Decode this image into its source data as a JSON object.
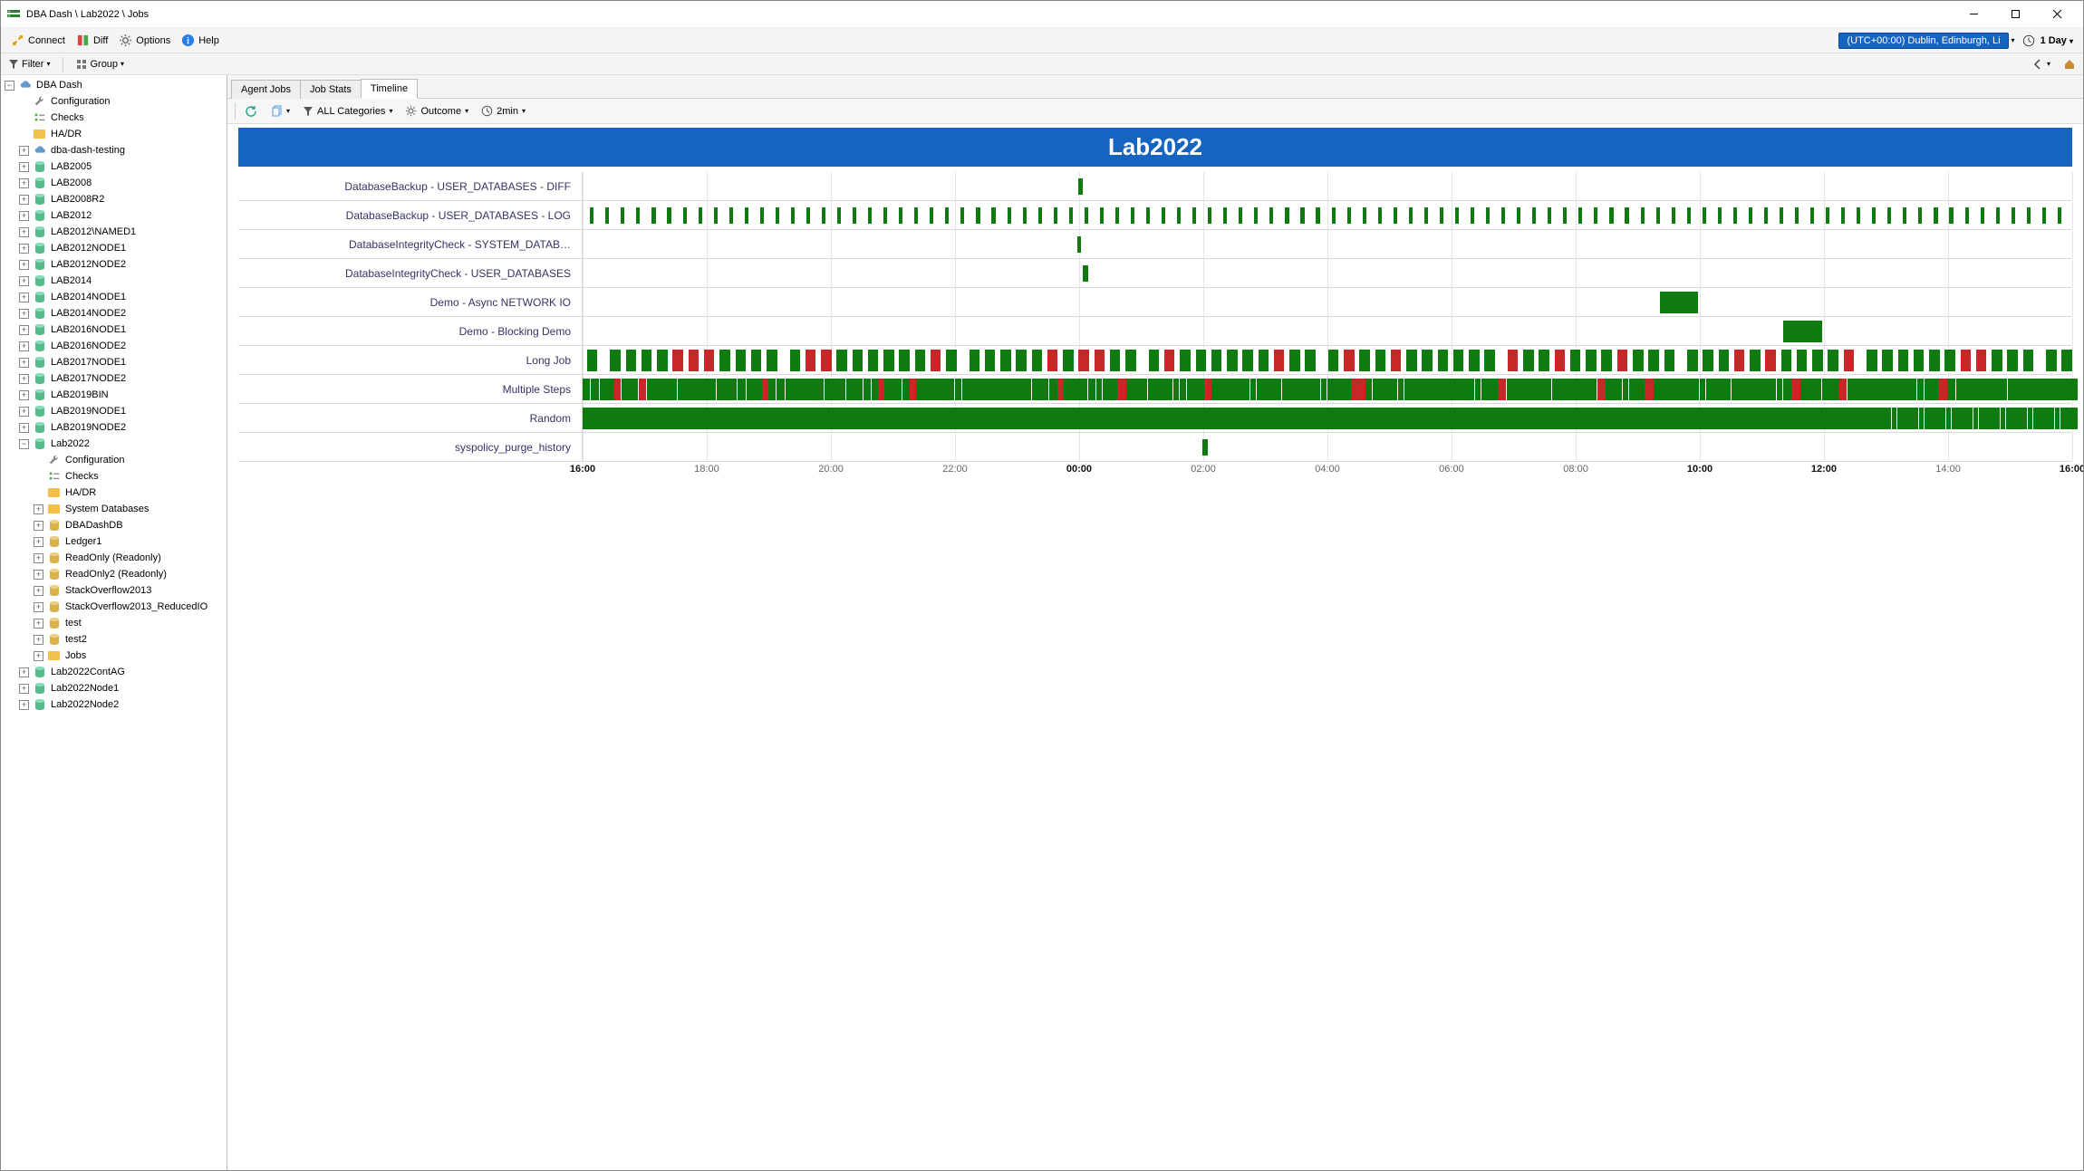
{
  "window": {
    "title": "DBA Dash \\ Lab2022 \\ Jobs"
  },
  "toolbar": {
    "connect": "Connect",
    "diff": "Diff",
    "options": "Options",
    "help": "Help",
    "tz": "(UTC+00:00) Dublin, Edinburgh, Li",
    "range": "1 Day"
  },
  "filterbar": {
    "filter": "Filter",
    "group": "Group"
  },
  "tabs": {
    "agentJobs": "Agent Jobs",
    "jobStats": "Job Stats",
    "timeline": "Timeline"
  },
  "subtoolbar": {
    "categories": "ALL Categories",
    "outcome": "Outcome",
    "granularity": "2min"
  },
  "timeline": {
    "title": "Lab2022",
    "ticks": [
      {
        "pos": 0,
        "label": "16:00",
        "major": true
      },
      {
        "pos": 8.33,
        "label": "18:00"
      },
      {
        "pos": 16.67,
        "label": "20:00"
      },
      {
        "pos": 25,
        "label": "22:00"
      },
      {
        "pos": 33.33,
        "label": "00:00",
        "major": true
      },
      {
        "pos": 41.67,
        "label": "02:00"
      },
      {
        "pos": 50,
        "label": "04:00"
      },
      {
        "pos": 58.33,
        "label": "06:00"
      },
      {
        "pos": 66.67,
        "label": "08:00"
      },
      {
        "pos": 75,
        "label": "10:00",
        "major": true
      },
      {
        "pos": 83.33,
        "label": "12:00",
        "major": true
      },
      {
        "pos": 91.67,
        "label": "14:00"
      },
      {
        "pos": 100,
        "label": "16:00",
        "major": true
      }
    ],
    "rows": [
      {
        "name": "DatabaseBackup - USER_DATABASES - DIFF",
        "bars": [
          {
            "x": 33.3,
            "w": 0.25,
            "c": "g",
            "thin": true
          }
        ]
      },
      {
        "name": "DatabaseBackup - USER_DATABASES - LOG",
        "pattern": "log"
      },
      {
        "name": "DatabaseIntegrityCheck - SYSTEM_DATAB…",
        "bars": [
          {
            "x": 33.2,
            "w": 0.25,
            "c": "g",
            "thin": true
          }
        ]
      },
      {
        "name": "DatabaseIntegrityCheck - USER_DATABASES",
        "bars": [
          {
            "x": 33.6,
            "w": 0.35,
            "c": "g",
            "thin": true
          }
        ]
      },
      {
        "name": "Demo - Async NETWORK IO",
        "bars": [
          {
            "x": 72.3,
            "w": 2.6,
            "c": "g",
            "wide": true
          }
        ]
      },
      {
        "name": "Demo - Blocking Demo",
        "bars": [
          {
            "x": 80.6,
            "w": 2.6,
            "c": "g",
            "wide": true
          }
        ]
      },
      {
        "name": "Long Job",
        "pattern": "longjob"
      },
      {
        "name": "Multiple Steps",
        "pattern": "multistep"
      },
      {
        "name": "Random",
        "pattern": "random"
      },
      {
        "name": "syspolicy_purge_history",
        "bars": [
          {
            "x": 41.6,
            "w": 0.35,
            "c": "g",
            "thin": true
          }
        ]
      }
    ]
  },
  "tree": [
    {
      "d": 0,
      "e": "-",
      "i": "cloud",
      "t": "DBA Dash"
    },
    {
      "d": 1,
      "e": "",
      "i": "wrench",
      "t": "Configuration"
    },
    {
      "d": 1,
      "e": "",
      "i": "checks",
      "t": "Checks"
    },
    {
      "d": 1,
      "e": "",
      "i": "folder",
      "t": "HA/DR"
    },
    {
      "d": 1,
      "e": "+",
      "i": "cloud",
      "t": "dba-dash-testing"
    },
    {
      "d": 1,
      "e": "+",
      "i": "db",
      "t": "LAB2005"
    },
    {
      "d": 1,
      "e": "+",
      "i": "db",
      "t": "LAB2008"
    },
    {
      "d": 1,
      "e": "+",
      "i": "db",
      "t": "LAB2008R2"
    },
    {
      "d": 1,
      "e": "+",
      "i": "db",
      "t": "LAB2012"
    },
    {
      "d": 1,
      "e": "+",
      "i": "db",
      "t": "LAB2012\\NAMED1"
    },
    {
      "d": 1,
      "e": "+",
      "i": "db",
      "t": "LAB2012NODE1"
    },
    {
      "d": 1,
      "e": "+",
      "i": "db",
      "t": "LAB2012NODE2"
    },
    {
      "d": 1,
      "e": "+",
      "i": "db",
      "t": "LAB2014"
    },
    {
      "d": 1,
      "e": "+",
      "i": "db",
      "t": "LAB2014NODE1"
    },
    {
      "d": 1,
      "e": "+",
      "i": "db",
      "t": "LAB2014NODE2"
    },
    {
      "d": 1,
      "e": "+",
      "i": "db",
      "t": "LAB2016NODE1"
    },
    {
      "d": 1,
      "e": "+",
      "i": "db",
      "t": "LAB2016NODE2"
    },
    {
      "d": 1,
      "e": "+",
      "i": "db",
      "t": "LAB2017NODE1"
    },
    {
      "d": 1,
      "e": "+",
      "i": "db",
      "t": "LAB2017NODE2"
    },
    {
      "d": 1,
      "e": "+",
      "i": "db",
      "t": "LAB2019BIN"
    },
    {
      "d": 1,
      "e": "+",
      "i": "db",
      "t": "LAB2019NODE1"
    },
    {
      "d": 1,
      "e": "+",
      "i": "db",
      "t": "LAB2019NODE2"
    },
    {
      "d": 1,
      "e": "-",
      "i": "db",
      "t": "Lab2022"
    },
    {
      "d": 2,
      "e": "",
      "i": "wrench",
      "t": "Configuration"
    },
    {
      "d": 2,
      "e": "",
      "i": "checks",
      "t": "Checks"
    },
    {
      "d": 2,
      "e": "",
      "i": "folder",
      "t": "HA/DR"
    },
    {
      "d": 2,
      "e": "+",
      "i": "folder",
      "t": "System Databases"
    },
    {
      "d": 2,
      "e": "+",
      "i": "dby",
      "t": "DBADashDB"
    },
    {
      "d": 2,
      "e": "+",
      "i": "dby",
      "t": "Ledger1"
    },
    {
      "d": 2,
      "e": "+",
      "i": "dby",
      "t": "ReadOnly (Readonly)"
    },
    {
      "d": 2,
      "e": "+",
      "i": "dby",
      "t": "ReadOnly2 (Readonly)"
    },
    {
      "d": 2,
      "e": "+",
      "i": "dby",
      "t": "StackOverflow2013"
    },
    {
      "d": 2,
      "e": "+",
      "i": "dby",
      "t": "StackOverflow2013_ReducedIO"
    },
    {
      "d": 2,
      "e": "+",
      "i": "dby",
      "t": "test"
    },
    {
      "d": 2,
      "e": "+",
      "i": "dby",
      "t": "test2"
    },
    {
      "d": 2,
      "e": "+",
      "i": "folder",
      "t": "Jobs"
    },
    {
      "d": 1,
      "e": "+",
      "i": "db",
      "t": "Lab2022ContAG"
    },
    {
      "d": 1,
      "e": "+",
      "i": "db",
      "t": "Lab2022Node1"
    },
    {
      "d": 1,
      "e": "+",
      "i": "db",
      "t": "Lab2022Node2"
    }
  ]
}
